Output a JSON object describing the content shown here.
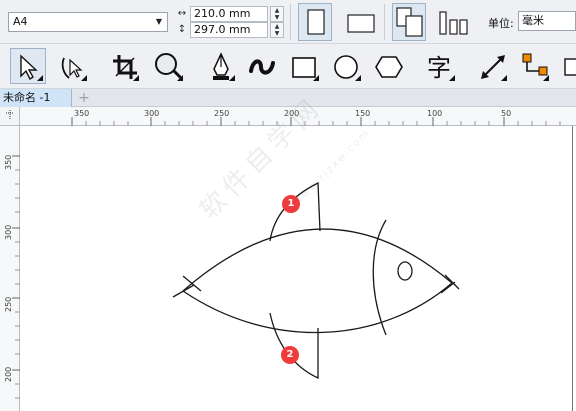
{
  "property_bar": {
    "page_size": "A4",
    "width_value": "210.0 mm",
    "height_value": "297.0 mm",
    "unit_label": "单位:",
    "unit_value": "毫米"
  },
  "document": {
    "tab_title": "未命名 -1",
    "add_tab_symbol": "+"
  },
  "rulers": {
    "horizontal_ticks": [
      "350",
      "300",
      "250",
      "200",
      "150",
      "100",
      "50"
    ],
    "vertical_ticks": [
      "350",
      "300",
      "250",
      "200"
    ]
  },
  "canvas": {
    "watermark": "软件自学网",
    "watermark_sub": "www.rjzxw.com",
    "badges": [
      "1",
      "2"
    ]
  },
  "colors": {
    "badge": "#ef3b3b",
    "toolbar_bg": "#eef0f3",
    "active_tab": "#cfe4f7"
  }
}
